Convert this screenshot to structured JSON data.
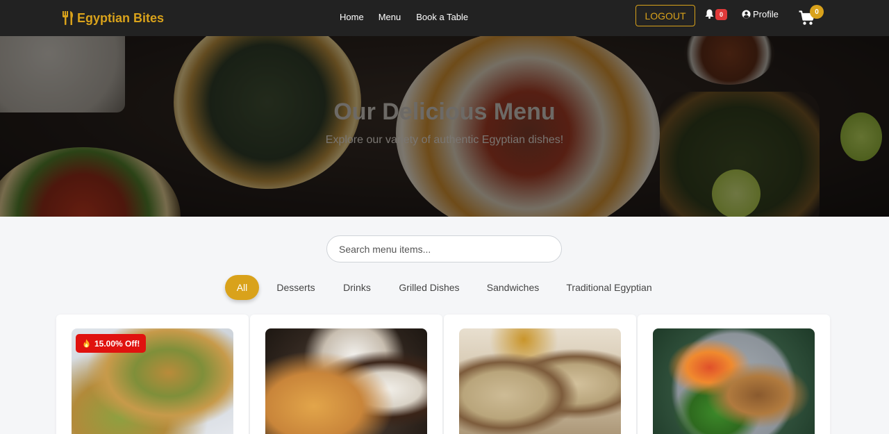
{
  "brand": {
    "name": "Egyptian Bites",
    "icon": "utensils-icon",
    "color": "#d9a21b"
  },
  "nav": {
    "links": [
      "Home",
      "Menu",
      "Book a Table"
    ]
  },
  "header": {
    "logout_label": "LOGOUT",
    "notification_count": "0",
    "profile_label": "Profile",
    "cart_count": "0"
  },
  "hero": {
    "title": "Our Delicious Menu",
    "subtitle": "Explore our variety of authentic Egyptian dishes!"
  },
  "search": {
    "placeholder": "Search menu items..."
  },
  "filters": [
    "All",
    "Desserts",
    "Drinks",
    "Grilled Dishes",
    "Sandwiches",
    "Traditional Egyptian"
  ],
  "cards": [
    {
      "image": "baklava-photo",
      "badge": "15.00% Off!",
      "badge_icon": "fire-icon"
    },
    {
      "image": "basbousa-coffee-photo"
    },
    {
      "image": "soup-bowls-photo"
    },
    {
      "image": "grilled-fish-photo"
    }
  ],
  "colors": {
    "accent": "#d9a21b",
    "navbar": "#222222",
    "danger": "#e03a3a",
    "badge": "#e0120f"
  }
}
